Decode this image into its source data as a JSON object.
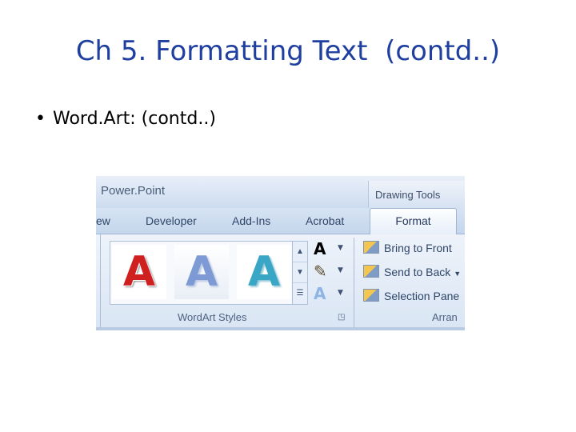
{
  "slide": {
    "title": "Ch 5. Formatting Text  (contd..)",
    "bullet": "Word.Art: (contd..)"
  },
  "screenshot": {
    "app_title": "Power.Point",
    "contextual_tab_group": "Drawing Tools",
    "tabs": [
      {
        "label": "ew"
      },
      {
        "label": "Developer"
      },
      {
        "label": "Add-Ins"
      },
      {
        "label": "Acrobat"
      },
      {
        "label": "Format",
        "active": true
      }
    ],
    "wordart_gallery": {
      "items": [
        {
          "glyph": "A",
          "style": "red"
        },
        {
          "glyph": "A",
          "style": "blue"
        },
        {
          "glyph": "A",
          "style": "teal"
        }
      ],
      "group_label": "WordArt Styles"
    },
    "text_format_buttons": [
      {
        "glyph": "A",
        "name": "text-fill"
      },
      {
        "glyph": "✎",
        "name": "text-outline"
      },
      {
        "glyph": "A",
        "name": "text-effects"
      }
    ],
    "arrange": {
      "items": [
        {
          "label": "Bring to Front",
          "has_dropdown": false
        },
        {
          "label": "Send to Back",
          "has_dropdown": true
        },
        {
          "label": "Selection Pane",
          "has_dropdown": false
        }
      ],
      "group_label": "Arran"
    },
    "colors": {
      "title_blue": "#1f3fa0",
      "ribbon_bg": "#dce7f5",
      "wordart_red": "#cf1f1f",
      "wordart_blue": "#7d9ad4",
      "wordart_teal": "#3aa6c6"
    }
  }
}
